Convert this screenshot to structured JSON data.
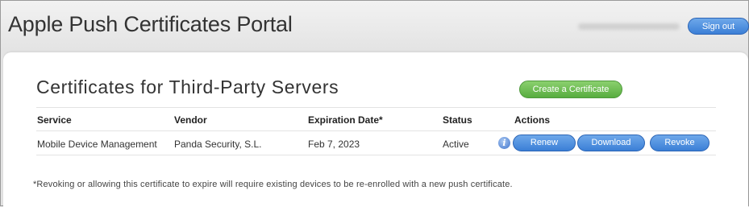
{
  "header": {
    "title": "Apple Push Certificates Portal",
    "signout_label": "Sign out"
  },
  "main": {
    "title": "Certificates for Third-Party Servers",
    "create_label": "Create a Certificate",
    "columns": [
      "Service",
      "Vendor",
      "Expiration Date*",
      "Status",
      "Actions"
    ],
    "rows": [
      {
        "service": "Mobile Device Management",
        "vendor": "Panda Security, S.L.",
        "expiration": "Feb 7, 2023",
        "status": "Active",
        "info_glyph": "i",
        "actions": [
          "Renew",
          "Download",
          "Revoke"
        ]
      }
    ],
    "footnote": "*Revoking or allowing this certificate to expire will require existing devices to be re-enrolled with a new push certificate."
  },
  "colors": {
    "primary_button": "#3b7fd6",
    "create_button": "#57ad3f"
  },
  "icons": {
    "info": "info-icon"
  }
}
